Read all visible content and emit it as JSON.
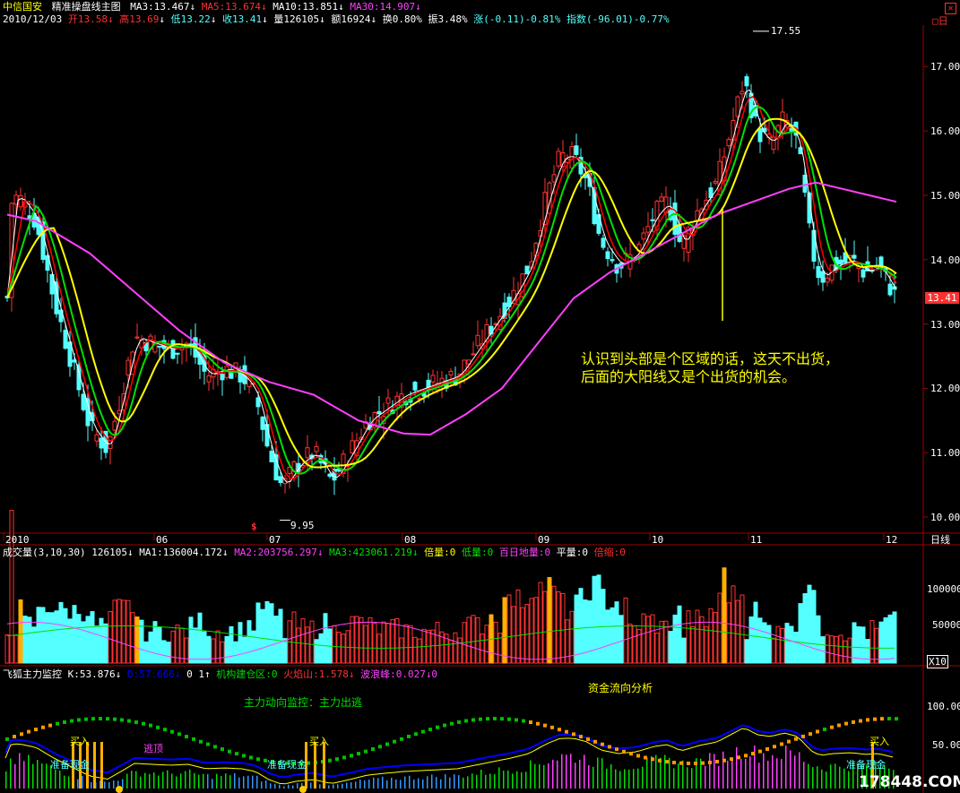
{
  "header": {
    "stock_name": "中信国安",
    "chart_name": "精准操盘线主图",
    "ma3": "MA3:13.467↓",
    "ma5": "MA5:13.674↓",
    "ma10": "MA10:13.851↓",
    "ma30": "MA30:14.907↓",
    "date": "2010/12/03",
    "open": "开13.58",
    "high": "高13.69",
    "low": "低13.22",
    "close": "收13.41",
    "volume": "量126105",
    "amount": "额16924",
    "turnover": "换0.80%",
    "amplitude": "振3.48%",
    "change": "涨(-0.11)-0.81%",
    "index": "指数(-96.01)-0.77%",
    "period_button": "日"
  },
  "main_chart": {
    "y_ticks": [
      "17.00",
      "16.00",
      "15.00",
      "14.00",
      "13.00",
      "12.00",
      "11.00",
      "10.00"
    ],
    "y_tick_values": [
      17,
      16,
      15,
      14,
      13,
      12,
      11,
      10
    ],
    "price_tag": "13.41",
    "high_label": "17.55",
    "low_label": "9.95",
    "annotation_line1": "认识到头部是个区域的话，这天不出货，",
    "annotation_line2": "后面的大阳线又是个出货的机会。",
    "signal_mark": "$"
  },
  "x_axis": {
    "labels": [
      "2010",
      "06",
      "07",
      "08",
      "09",
      "10",
      "11",
      "12"
    ],
    "period_label": "日线"
  },
  "volume_panel": {
    "title": "成交量(3,10,30) 126105↓",
    "ma1": "MA1:136004.172↓",
    "ma2": "MA2:203756.297↓",
    "ma3": "MA3:423061.219↓",
    "beiliang": "倍量:0",
    "diliang": "低量:0",
    "bairi": "百日地量:0",
    "pingliang": "平量:0",
    "beisuo": "倍缩:0",
    "y_ticks": [
      "100000",
      "50000"
    ],
    "unit": "X10"
  },
  "indicator_panel": {
    "title": "飞狐主力监控",
    "k": "K:53.876↓",
    "d": "D:57.666↓",
    "pair": "0 1↑",
    "jiancang": "机构建仓区:0",
    "huoyan": "火焰山:1.578↓",
    "bolang": "波浪峰:0.027↓0",
    "fund_flow": "资金流向分析",
    "monitor": "主力动向监控：主力出逃",
    "buy1": "买入",
    "buy2": "买入",
    "buy3": "买入",
    "escape": "逃顶",
    "ready1": "准备现金",
    "ready2": "准备现金",
    "ready3": "准备现金",
    "y_ticks": [
      "100.00",
      "50.00"
    ],
    "watermark": "178448.COM"
  },
  "colors": {
    "up": "#ff3232",
    "down": "#54ffff",
    "ma3": "#ffffff",
    "ma5": "#ff0000",
    "ma10": "#00e000",
    "ma30_yellow": "#ffff00",
    "ma_long": "#ff40ff",
    "axis": "#a00000"
  }
}
